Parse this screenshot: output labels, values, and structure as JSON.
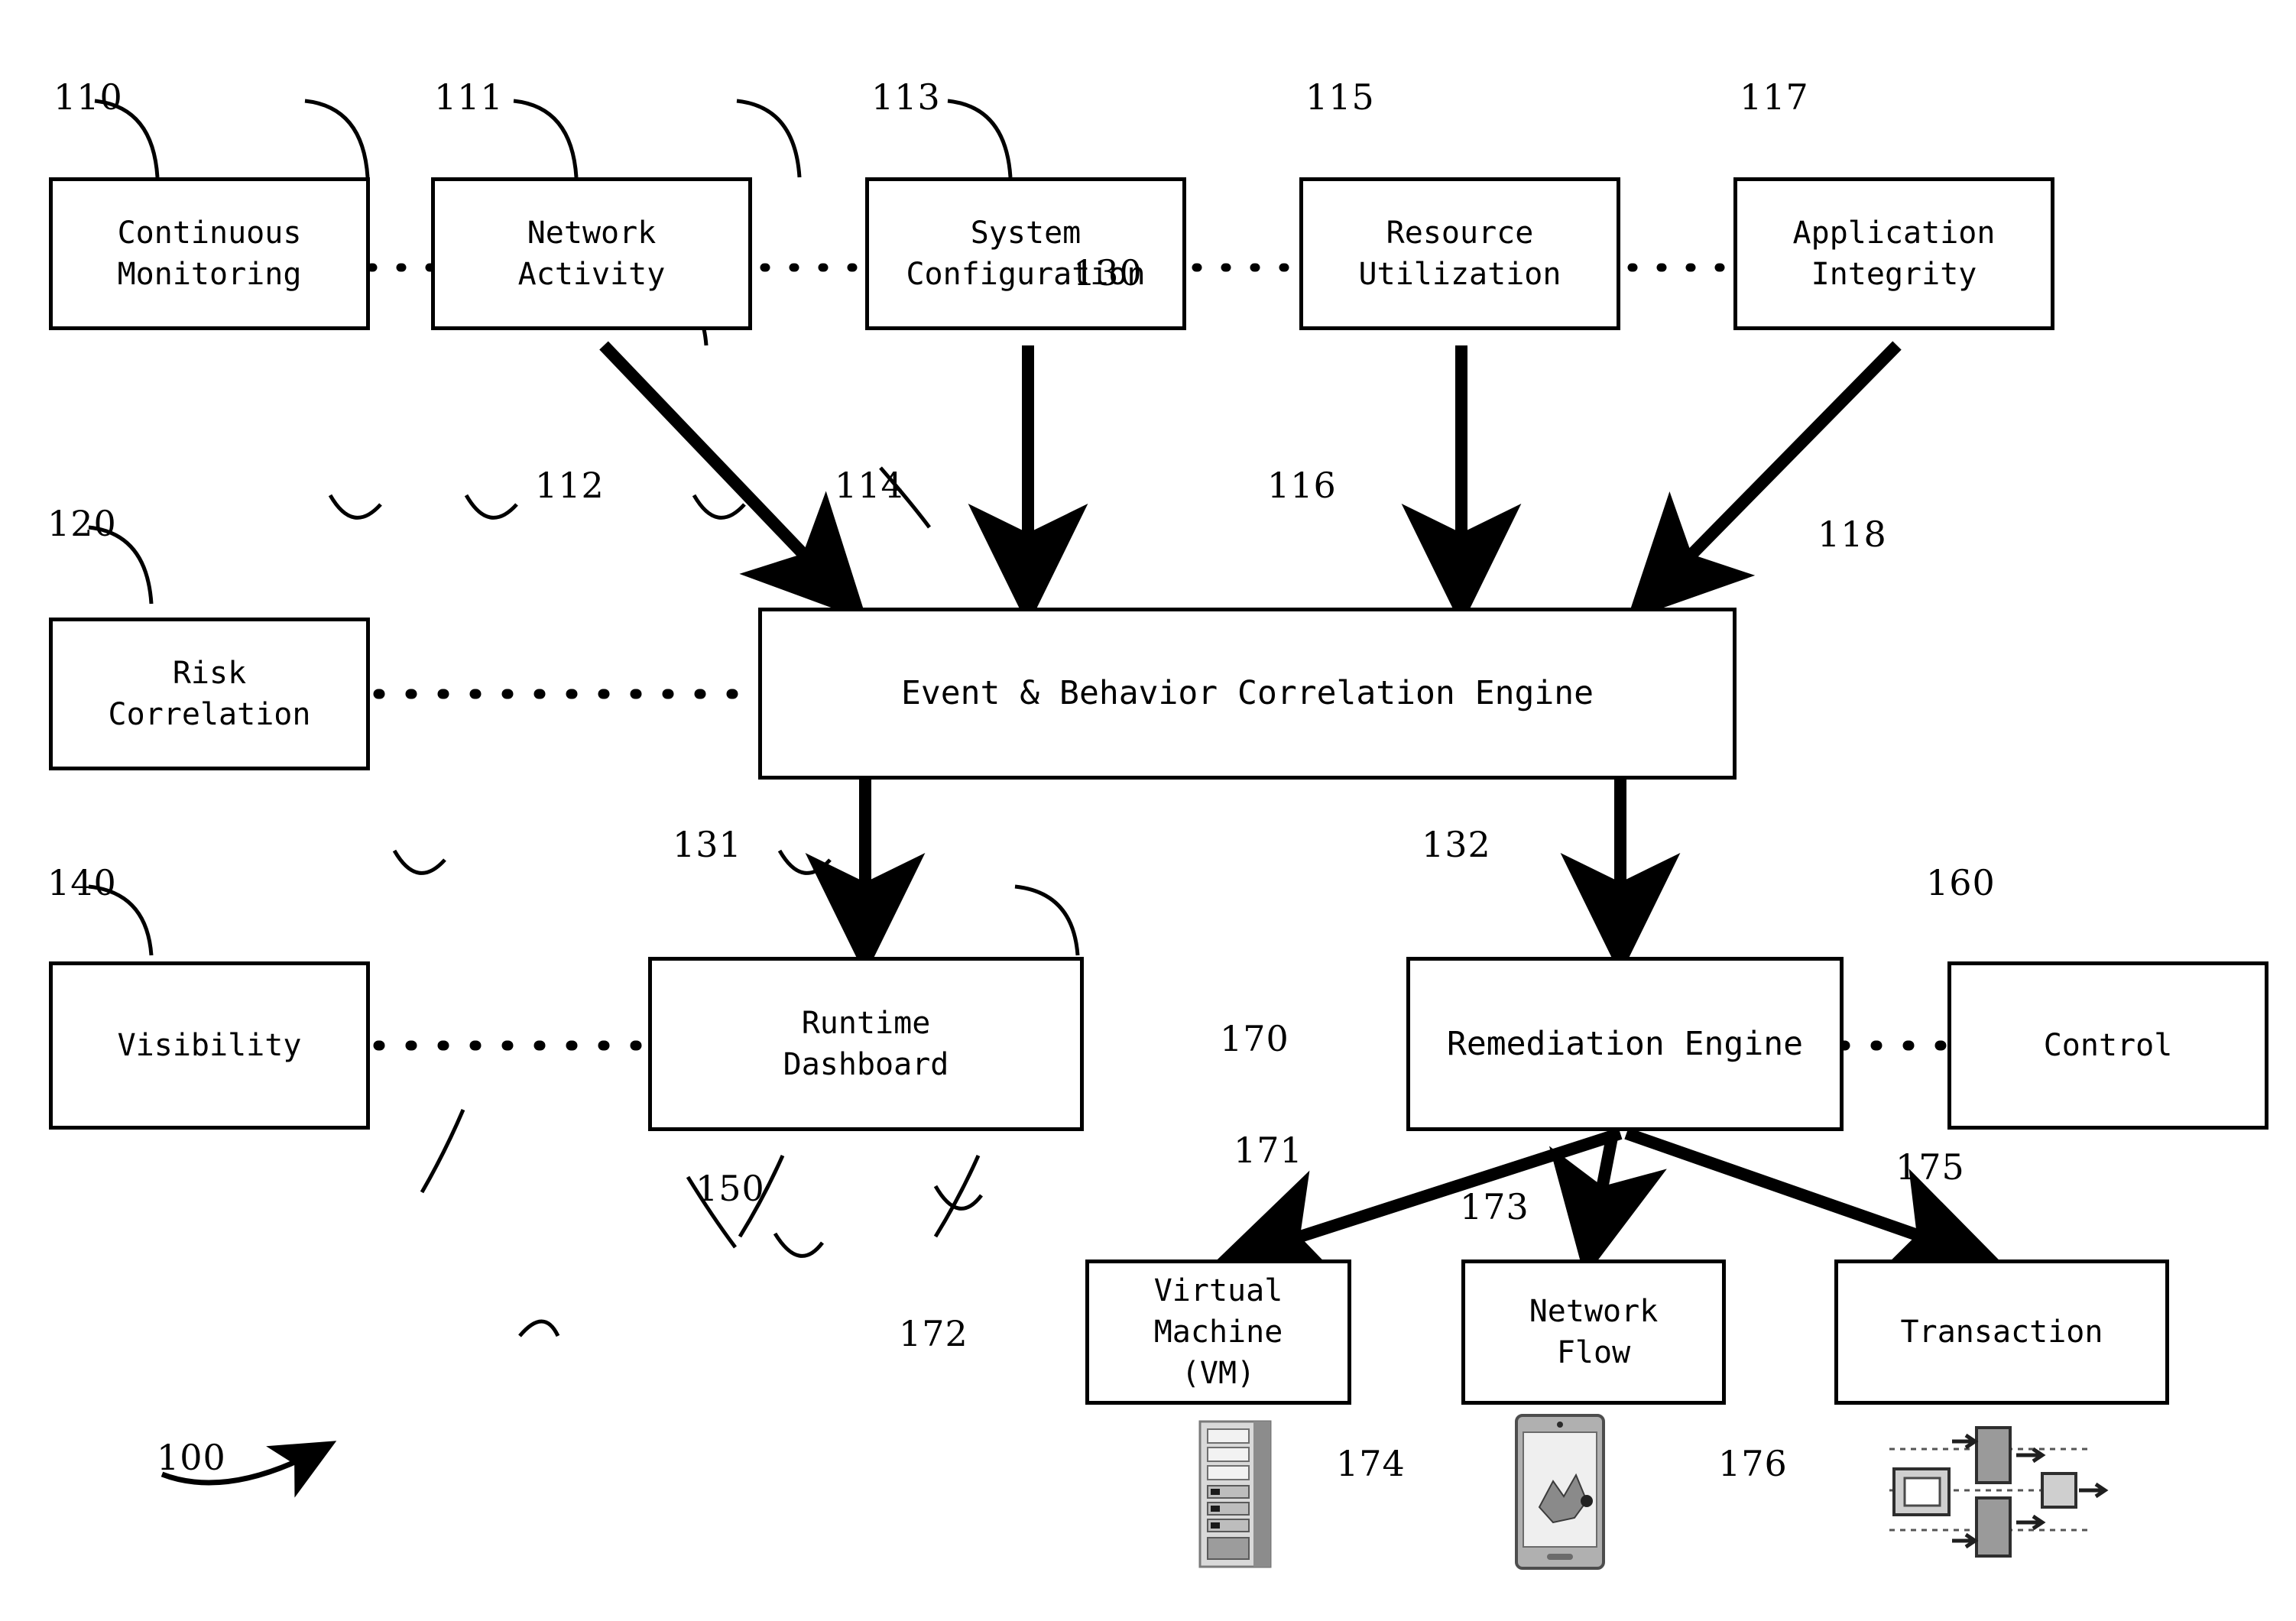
{
  "figure": {
    "system_ref": "100",
    "nodes": [
      {
        "id": "continuous-monitoring",
        "ref": "110",
        "label": "Continuous\nMonitoring"
      },
      {
        "id": "network-activity",
        "ref": "111",
        "label": "Network\nActivity"
      },
      {
        "id": "system-configuration",
        "ref": "113",
        "label": "System\nConfiguration"
      },
      {
        "id": "resource-utilization",
        "ref": "115",
        "label": "Resource\nUtilization"
      },
      {
        "id": "application-integrity",
        "ref": "117",
        "label": "Application\nIntegrity"
      },
      {
        "id": "risk-correlation",
        "ref": "120",
        "label": "Risk\nCorrelation"
      },
      {
        "id": "correlation-engine",
        "ref": "130",
        "label": "Event & Behavior Correlation Engine"
      },
      {
        "id": "visibility",
        "ref": "140",
        "label": "Visibility"
      },
      {
        "id": "runtime-dashboard",
        "ref": "150",
        "label": "Runtime\nDashboard"
      },
      {
        "id": "control",
        "ref": "160",
        "label": "Control"
      },
      {
        "id": "remediation-engine",
        "ref": "170",
        "label": "Remediation Engine"
      },
      {
        "id": "virtual-machine",
        "ref": "172",
        "label": "Virtual\nMachine\n(VM)"
      },
      {
        "id": "network-flow",
        "ref": "174",
        "label": "Network\nFlow"
      },
      {
        "id": "transaction",
        "ref": "176",
        "label": "Transaction"
      }
    ],
    "connector_refs": [
      {
        "id": "conn-112",
        "ref": "112"
      },
      {
        "id": "conn-114",
        "ref": "114"
      },
      {
        "id": "conn-116",
        "ref": "116"
      },
      {
        "id": "conn-118",
        "ref": "118"
      },
      {
        "id": "conn-131",
        "ref": "131"
      },
      {
        "id": "conn-132",
        "ref": "132"
      },
      {
        "id": "conn-171",
        "ref": "171"
      },
      {
        "id": "conn-173",
        "ref": "173"
      },
      {
        "id": "conn-175",
        "ref": "175"
      }
    ],
    "icons": [
      {
        "id": "server-rack-icon",
        "name": "server-rack-icon"
      },
      {
        "id": "tablet-device-icon",
        "name": "tablet-device-icon"
      },
      {
        "id": "network-topology-icon",
        "name": "network-topology-icon"
      }
    ],
    "colors": {
      "stroke": "#000000",
      "background": "#ffffff"
    }
  }
}
